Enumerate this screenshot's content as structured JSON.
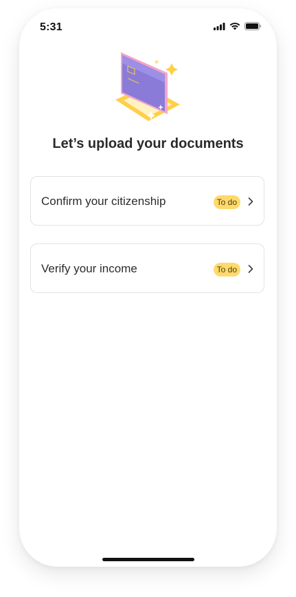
{
  "status_bar": {
    "time": "5:31",
    "icons": [
      "signal-icon",
      "wifi-icon",
      "battery-icon"
    ]
  },
  "hero": {
    "illustration": "document-card-illustration"
  },
  "title": "Let’s upload your documents",
  "documents": [
    {
      "label": "Confirm your citizenship",
      "status": "To do"
    },
    {
      "label": "Verify your income",
      "status": "To do"
    }
  ],
  "colors": {
    "badge_bg": "#ffd96b",
    "card_border": "#e2e2e2",
    "accent_purple": "#8b7bd8",
    "accent_pink": "#f3a6c9",
    "accent_yellow": "#ffcf48"
  }
}
